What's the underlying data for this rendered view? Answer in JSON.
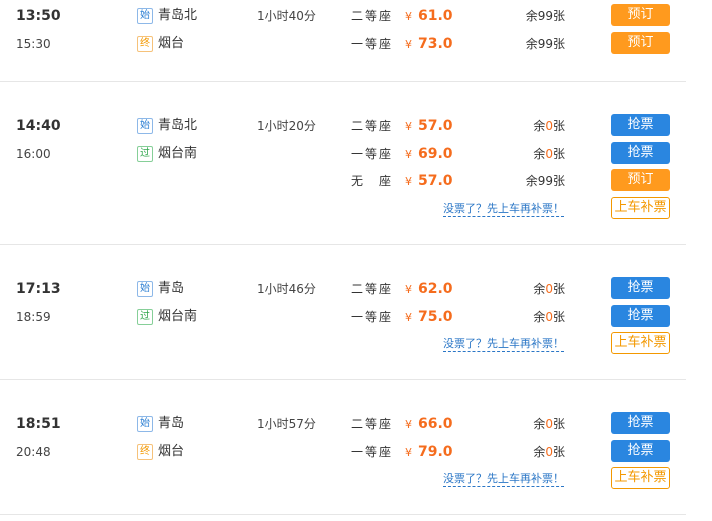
{
  "trains": [
    {
      "departure_time": "13:50",
      "arrival_time": "15:30",
      "from": {
        "mark": "始",
        "name": "青岛北"
      },
      "to": {
        "mark": "终",
        "name": "烟台"
      },
      "duration": "1小时40分",
      "seats": [
        {
          "class": "二等座",
          "currency": "¥",
          "price": "61.0",
          "remain_prefix": "余",
          "remain_count": "99",
          "remain_suffix": "张",
          "action": "预订"
        },
        {
          "class": "一等座",
          "currency": "¥",
          "price": "73.0",
          "remain_prefix": "余",
          "remain_count": "99",
          "remain_suffix": "张",
          "action": "预订"
        }
      ]
    },
    {
      "departure_time": "14:40",
      "arrival_time": "16:00",
      "from": {
        "mark": "始",
        "name": "青岛北"
      },
      "to": {
        "mark": "过",
        "name": "烟台南"
      },
      "duration": "1小时20分",
      "seats": [
        {
          "class": "二等座",
          "currency": "¥",
          "price": "57.0",
          "remain_prefix": "余",
          "remain_count": "0",
          "remain_suffix": "张",
          "action": "抢票"
        },
        {
          "class": "一等座",
          "currency": "¥",
          "price": "69.0",
          "remain_prefix": "余",
          "remain_count": "0",
          "remain_suffix": "张",
          "action": "抢票"
        },
        {
          "class": "无座",
          "currency": "¥",
          "price": "57.0",
          "remain_prefix": "余",
          "remain_count": "99",
          "remain_suffix": "张",
          "action": "预订"
        }
      ],
      "hint": "没票了？先上车再补票！",
      "extra_action": "上车补票"
    },
    {
      "departure_time": "17:13",
      "arrival_time": "18:59",
      "from": {
        "mark": "始",
        "name": "青岛"
      },
      "to": {
        "mark": "过",
        "name": "烟台南"
      },
      "duration": "1小时46分",
      "seats": [
        {
          "class": "二等座",
          "currency": "¥",
          "price": "62.0",
          "remain_prefix": "余",
          "remain_count": "0",
          "remain_suffix": "张",
          "action": "抢票"
        },
        {
          "class": "一等座",
          "currency": "¥",
          "price": "75.0",
          "remain_prefix": "余",
          "remain_count": "0",
          "remain_suffix": "张",
          "action": "抢票"
        }
      ],
      "hint": "没票了？先上车再补票！",
      "extra_action": "上车补票"
    },
    {
      "departure_time": "18:51",
      "arrival_time": "20:48",
      "from": {
        "mark": "始",
        "name": "青岛"
      },
      "to": {
        "mark": "终",
        "name": "烟台"
      },
      "duration": "1小时57分",
      "seats": [
        {
          "class": "二等座",
          "currency": "¥",
          "price": "66.0",
          "remain_prefix": "余",
          "remain_count": "0",
          "remain_suffix": "张",
          "action": "抢票"
        },
        {
          "class": "一等座",
          "currency": "¥",
          "price": "79.0",
          "remain_prefix": "余",
          "remain_count": "0",
          "remain_suffix": "张",
          "action": "抢票"
        }
      ],
      "hint": "没票了？先上车再补票！",
      "extra_action": "上车补票"
    }
  ],
  "colors": {
    "price": "#f56c1d",
    "book_button": "#ff9a1e",
    "grab_button": "#2a86e0",
    "hint_link": "#2a76c6"
  }
}
